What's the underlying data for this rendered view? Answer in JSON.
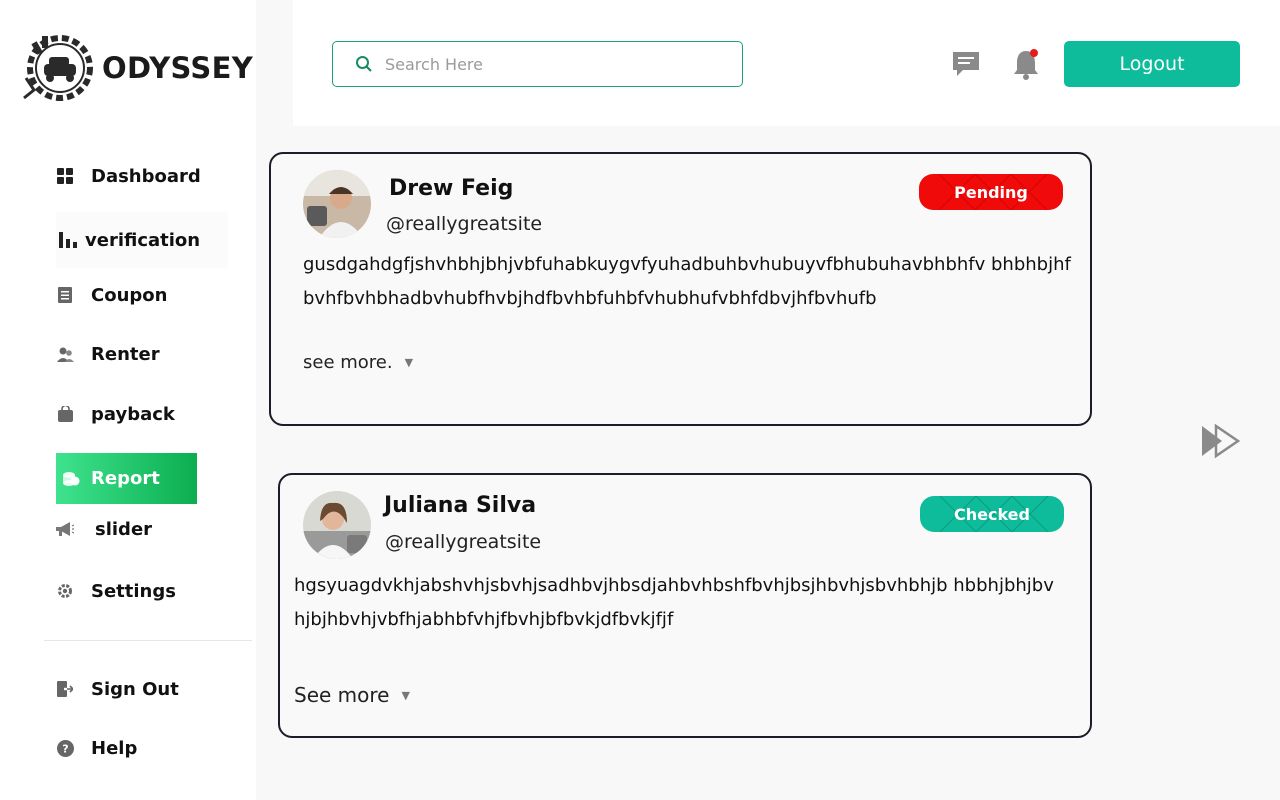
{
  "brand": {
    "name": "ODYSSEY"
  },
  "colors": {
    "accent": "#0ebc9c",
    "active_nav": "#0bae4f",
    "pending": "#f00a0a",
    "checked": "#0ebc9c",
    "notification_dot": "#e11d1d"
  },
  "sidebar": {
    "items": [
      {
        "label": "Dashboard",
        "icon": "grid-icon"
      },
      {
        "label": "verification",
        "icon": "bar-chart-icon"
      },
      {
        "label": "Coupon",
        "icon": "document-icon"
      },
      {
        "label": "Renter",
        "icon": "users-icon"
      },
      {
        "label": "payback",
        "icon": "bag-icon"
      },
      {
        "label": "Report",
        "icon": "coins-icon",
        "active": true
      },
      {
        "label": "slider",
        "icon": "megaphone-icon"
      },
      {
        "label": "Settings",
        "icon": "gear-icon"
      }
    ],
    "bottom": [
      {
        "label": "Sign Out",
        "icon": "sign-out-icon"
      },
      {
        "label": "Help",
        "icon": "help-icon"
      }
    ]
  },
  "header": {
    "search_placeholder": "Search Here",
    "logout_label": "Logout"
  },
  "reports": [
    {
      "name": "Drew Feig",
      "handle": "@reallygreatsite",
      "status": "Pending",
      "text": "gusdgahdgfjshvhbhjbhjvbfuhabkuygvfyuhadbuhbvhubuyvfbhubuhavbhbhfv bhbhbjhfbvhfbvhbhadbvhubfhvbjhdfbvhbfuhbfvhubhufvbhfdbvjhfbvhufb",
      "see_more": "see more."
    },
    {
      "name": "Juliana Silva",
      "handle": "@reallygreatsite",
      "status": "Checked",
      "text": "hgsyuagdvkhjabshvhjsbvhjsadhbvjhbsdjahbvhbshfbvhjbsjhbvhjsbvhbhjb hbbhjbhjbvhjbjhbvhjvbfhjabhbfvhjfbvhjbfbvkjdfbvkjfjf",
      "see_more": "See more"
    }
  ]
}
